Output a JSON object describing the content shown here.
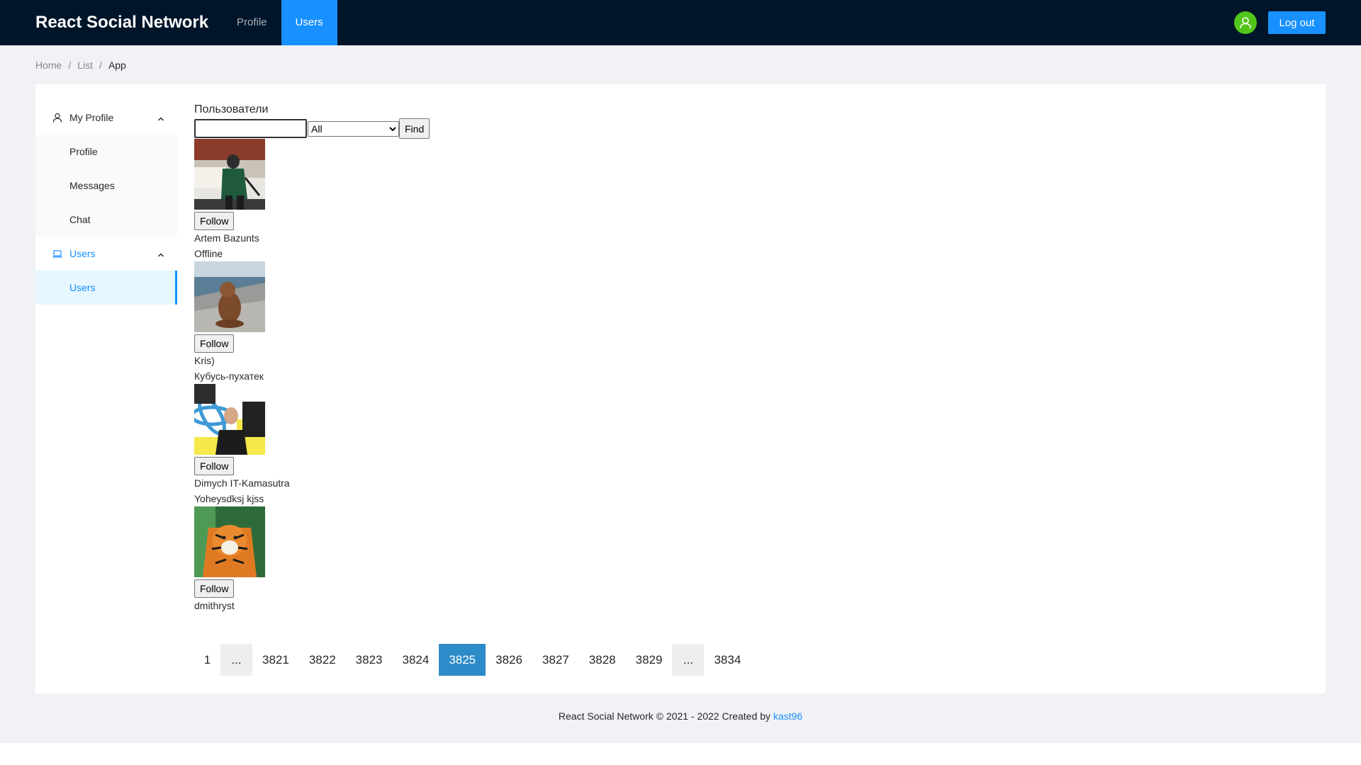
{
  "header": {
    "logo": "React Social Network",
    "nav": [
      {
        "label": "Profile",
        "active": false
      },
      {
        "label": "Users",
        "active": true
      }
    ],
    "avatar_icon": "user-icon",
    "logout_label": "Log out"
  },
  "breadcrumb": [
    "Home",
    "List",
    "App"
  ],
  "sider": {
    "groups": [
      {
        "title": "My Profile",
        "icon": "user-icon",
        "active": false,
        "items": [
          {
            "label": "Profile",
            "selected": false
          },
          {
            "label": "Messages",
            "selected": false
          },
          {
            "label": "Chat",
            "selected": false
          }
        ]
      },
      {
        "title": "Users",
        "icon": "laptop-icon",
        "active": true,
        "items": [
          {
            "label": "Users",
            "selected": true
          }
        ]
      }
    ]
  },
  "main": {
    "title": "Пользователи",
    "search": {
      "value": "",
      "placeholder": ""
    },
    "filter": {
      "selected": "All"
    },
    "find_label": "Find",
    "users": [
      {
        "follow_label": "Follow",
        "name": "Artem Bazunts",
        "status": "Offline"
      },
      {
        "follow_label": "Follow",
        "name": "Kris)",
        "status": "Кубусь-пухатек"
      },
      {
        "follow_label": "Follow",
        "name": "Dimych IT-Kamasutra",
        "status": "Yoheysdksj kjss"
      },
      {
        "follow_label": "Follow",
        "name": "dmithryst",
        "status": ""
      }
    ],
    "pagination": {
      "pages": [
        "1",
        "...",
        "3821",
        "3822",
        "3823",
        "3824",
        "3825",
        "3826",
        "3827",
        "3828",
        "3829",
        "...",
        "3834"
      ],
      "current": "3825"
    }
  },
  "footer": {
    "text": "React Social Network © 2021 - 2022 Created by ",
    "link": "kast96"
  },
  "colors": {
    "header_bg": "#001529",
    "accent": "#1890ff",
    "layout_bg": "#f0f2f5",
    "avatar_bg": "#52c41a"
  }
}
